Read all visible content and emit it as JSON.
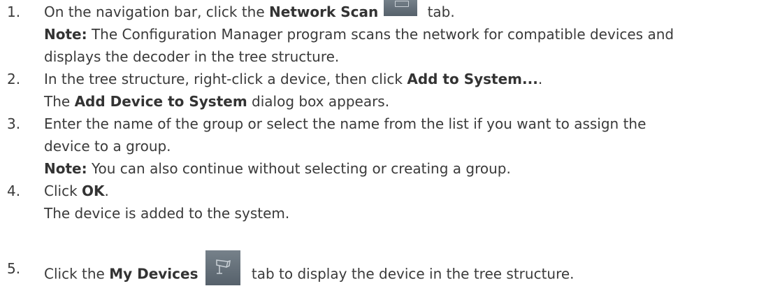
{
  "steps": [
    {
      "num": "1.",
      "line1_pre": "On the navigation bar, click the ",
      "line1_bold": "Network Scan",
      "line1_post": " tab.",
      "note_label": "Note:",
      "note_line1": " The Configuration Manager program scans the network for compatible devices and",
      "note_line2": "displays the decoder in the tree structure."
    },
    {
      "num": "2.",
      "line1_pre": "In the tree structure, right-click a device, then click ",
      "line1_bold": "Add to System...",
      "line1_post": ".",
      "line2_pre": "The ",
      "line2_bold": "Add Device to System",
      "line2_post": " dialog box appears."
    },
    {
      "num": "3.",
      "line1": "Enter the name of the group or select the name from the list if you want to assign the",
      "line2": "device to a group.",
      "note_label": "Note:",
      "note_text": " You can also continue without selecting or creating a group."
    },
    {
      "num": "4.",
      "line1_pre": "Click ",
      "line1_bold": "OK",
      "line1_post": ".",
      "line2": "The device is added to the system."
    },
    {
      "num": "5.",
      "line1_pre": "Click the ",
      "line1_bold": "My Devices",
      "line1_post": " tab to display the device in the tree structure."
    }
  ],
  "icons": {
    "network_scan": "network-scan-tab-icon",
    "my_devices": "my-devices-tab-icon"
  },
  "colors": {
    "text": "#3a3a3a",
    "icon_bg": "#66717b"
  }
}
